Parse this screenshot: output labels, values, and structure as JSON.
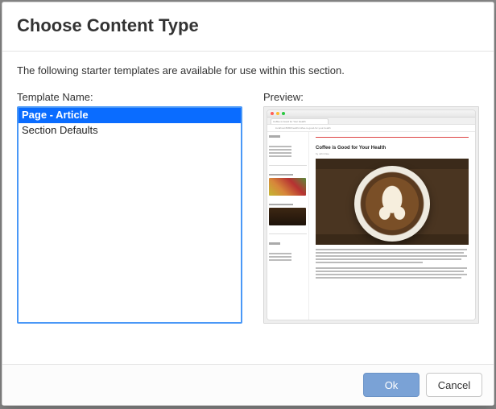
{
  "dialog": {
    "title": "Choose Content Type",
    "intro": "The following starter templates are available for use within this section."
  },
  "left": {
    "label": "Template Name:",
    "items": [
      {
        "label": "Page - Article",
        "selected": true
      },
      {
        "label": "Section Defaults",
        "selected": false
      }
    ]
  },
  "right": {
    "label": "Preview:"
  },
  "preview": {
    "tab_title": "Coffee is Good for Your Health",
    "url": "localhost:8080/health/coffee-is-good-for-your-health",
    "headline": "Coffee is Good for Your Health",
    "byline": "by John Doe"
  },
  "buttons": {
    "ok": "Ok",
    "cancel": "Cancel"
  }
}
